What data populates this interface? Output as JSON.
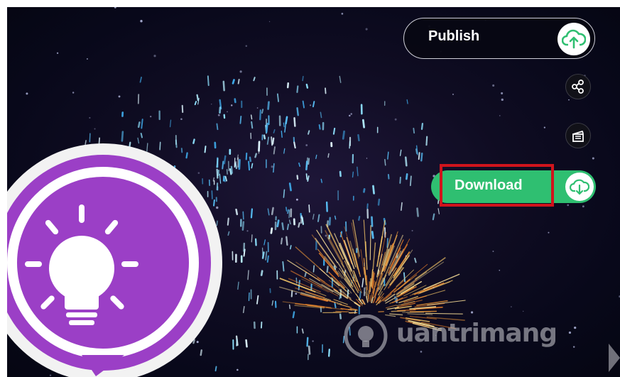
{
  "toolbar": {
    "publish_label": "Publish",
    "download_label": "Download"
  },
  "icons": {
    "publish": "cloud-upload-icon",
    "share": "share-icon",
    "clapperboard": "clapperboard-icon",
    "download": "cloud-download-icon"
  },
  "watermark": {
    "text": "uantrimang"
  },
  "colors": {
    "accent_green": "#2fbf71",
    "highlight_red": "#d0141c",
    "logo_purple": "#9b3fc6",
    "background_dark": "#0b0a1c"
  }
}
